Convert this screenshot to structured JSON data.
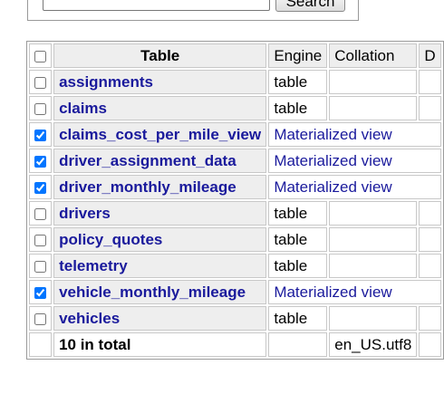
{
  "search": {
    "value": "",
    "button_label": "Search"
  },
  "headers": {
    "table": "Table",
    "engine": "Engine",
    "collation": "Collation",
    "data": "D"
  },
  "rows": [
    {
      "name": "assignments",
      "engine": "table",
      "collation": "",
      "checked": false,
      "view": false
    },
    {
      "name": "claims",
      "engine": "table",
      "collation": "",
      "checked": false,
      "view": false
    },
    {
      "name": "claims_cost_per_mile_view",
      "engine": "Materialized view",
      "collation": "",
      "checked": true,
      "view": true
    },
    {
      "name": "driver_assignment_data",
      "engine": "Materialized view",
      "collation": "",
      "checked": true,
      "view": true
    },
    {
      "name": "driver_monthly_mileage",
      "engine": "Materialized view",
      "collation": "",
      "checked": true,
      "view": true
    },
    {
      "name": "drivers",
      "engine": "table",
      "collation": "",
      "checked": false,
      "view": false
    },
    {
      "name": "policy_quotes",
      "engine": "table",
      "collation": "",
      "checked": false,
      "view": false
    },
    {
      "name": "telemetry",
      "engine": "table",
      "collation": "",
      "checked": false,
      "view": false
    },
    {
      "name": "vehicle_monthly_mileage",
      "engine": "Materialized view",
      "collation": "",
      "checked": true,
      "view": true
    },
    {
      "name": "vehicles",
      "engine": "table",
      "collation": "",
      "checked": false,
      "view": false
    }
  ],
  "footer": {
    "total": "10 in total",
    "collation": "en_US.utf8"
  }
}
